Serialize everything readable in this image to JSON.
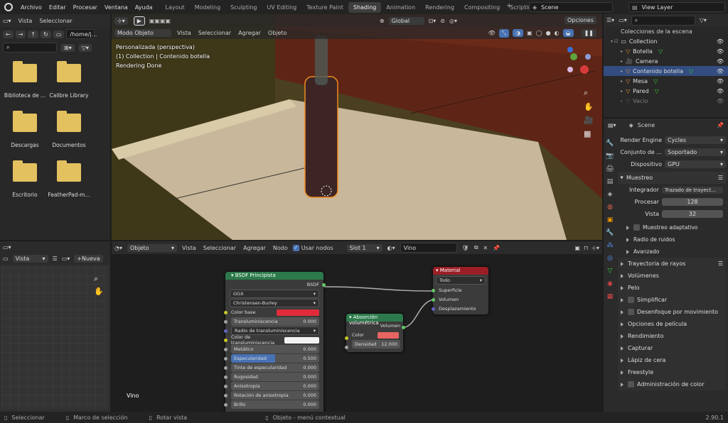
{
  "topmenu": [
    "Archivo",
    "Editar",
    "Procesar",
    "Ventana",
    "Ayuda"
  ],
  "workspaces": [
    {
      "label": "Layout",
      "active": false
    },
    {
      "label": "Modeling",
      "active": false
    },
    {
      "label": "Sculpting",
      "active": false
    },
    {
      "label": "UV Editing",
      "active": false
    },
    {
      "label": "Texture Paint",
      "active": false
    },
    {
      "label": "Shading",
      "active": true
    },
    {
      "label": "Animation",
      "active": false
    },
    {
      "label": "Rendering",
      "active": false
    },
    {
      "label": "Compositing",
      "active": false
    },
    {
      "label": "Scripting",
      "active": false
    }
  ],
  "scene": {
    "name": "Scene",
    "view_layer": "View Layer"
  },
  "filebrowser": {
    "menu": [
      "Vista",
      "Seleccionar"
    ],
    "path": "/home/j...",
    "items": [
      "Biblioteca de ...",
      "Calibre Library",
      "Descargas",
      "Documentos",
      "Escritorio",
      "FeatherPad-m..."
    ]
  },
  "viewport": {
    "mode": "Modo Objeto",
    "menus": [
      "Vista",
      "Seleccionar",
      "Agregar",
      "Objeto"
    ],
    "orientation": "Global",
    "options": "Opciones",
    "overlay": [
      "Personalizada (perspectiva)",
      "(1) Collection | Contenido botella",
      "Rendering Done"
    ]
  },
  "outliner": {
    "title": "Colecciones de la escena",
    "items": [
      {
        "label": "Collection",
        "indent": 0,
        "selected": false,
        "dim": false
      },
      {
        "label": "Botella",
        "indent": 1,
        "selected": false,
        "dim": false
      },
      {
        "label": "Camera",
        "indent": 1,
        "selected": false,
        "dim": false
      },
      {
        "label": "Contenido botella",
        "indent": 1,
        "selected": true,
        "dim": false
      },
      {
        "label": "Mesa",
        "indent": 1,
        "selected": false,
        "dim": false
      },
      {
        "label": "Pared",
        "indent": 1,
        "selected": false,
        "dim": false
      },
      {
        "label": "Vacío",
        "indent": 1,
        "selected": false,
        "dim": true
      }
    ]
  },
  "properties": {
    "scene": "Scene",
    "render_engine": {
      "label": "Render Engine",
      "value": "Cycles"
    },
    "feature_set": {
      "label": "Conjunto de ...",
      "value": "Soportado"
    },
    "device": {
      "label": "Dispositivo",
      "value": "GPU"
    },
    "sampling": {
      "title": "Muestreo",
      "integrator_label": "Integrador",
      "integrator": "Trazado de trayect...",
      "render_label": "Procesar",
      "render": "128",
      "viewport_label": "Vista",
      "viewport": "32",
      "sub": [
        "Muestreo adaptativo",
        "Radio de ruidos",
        "Avanzado"
      ]
    },
    "panels": [
      "Trayectoria de rayos",
      "Volúmenes",
      "Pelo",
      "Simplificar",
      "Desenfoque por movimiento",
      "Opciones de película",
      "Rendimiento",
      "Capturar",
      "Lápiz de cera",
      "Freestyle",
      "Administración de color"
    ]
  },
  "imageeditor": {
    "view": "Vista",
    "new": "Nueva"
  },
  "nodeeditor": {
    "object": "Objeto",
    "menus": [
      "Vista",
      "Seleccionar",
      "Agregar",
      "Nodo"
    ],
    "use_nodes": "Usar nodos",
    "slot": "Slot 1",
    "material": "Vino",
    "label": "Vino"
  },
  "bsdf": {
    "title": "BSDF Principista",
    "output": "BSDF",
    "dist": "GGX",
    "sss": "Christensen-Burley",
    "rows": [
      {
        "label": "Color base",
        "value": "",
        "kind": "color"
      },
      {
        "label": "Transluminiscencia",
        "value": "0.000",
        "kind": "slider"
      },
      {
        "label": "Radio de transluminiscencia",
        "value": "",
        "kind": "dropdown"
      },
      {
        "label": "Color de transluminiscencia",
        "value": "",
        "kind": "white"
      },
      {
        "label": "Metálico",
        "value": "0.000",
        "kind": "slider"
      },
      {
        "label": "Especularidad",
        "value": "0.500",
        "kind": "blue"
      },
      {
        "label": "Tinte de especularidad",
        "value": "0.000",
        "kind": "slider"
      },
      {
        "label": "Rugosidad",
        "value": "0.000",
        "kind": "slider"
      },
      {
        "label": "Anisotropía",
        "value": "0.000",
        "kind": "slider"
      },
      {
        "label": "Rotación de anisotropía",
        "value": "0.000",
        "kind": "slider"
      },
      {
        "label": "Brillo",
        "value": "0.000",
        "kind": "slider"
      }
    ]
  },
  "absorb": {
    "title": "Absorción volumétrica",
    "output": "Volumen",
    "color": "Color",
    "density_label": "Densidad",
    "density": "12.000"
  },
  "matout": {
    "title": "Material",
    "target": "Todo",
    "inputs": [
      "Superficie",
      "Volumen",
      "Desplazamiento"
    ]
  },
  "statusbar": {
    "items": [
      "Seleccionar",
      "Marco de selección",
      "Rotar vista",
      "Objeto - menú contextual"
    ],
    "version": "2.90.1"
  },
  "colors": {
    "accent": "#4772b3",
    "selected": "#334d80",
    "bsdf_header": "#2c7a4b",
    "material_header": "#9b1e26",
    "base_color": "#e22b3a",
    "absorb_color": "#e76461"
  }
}
